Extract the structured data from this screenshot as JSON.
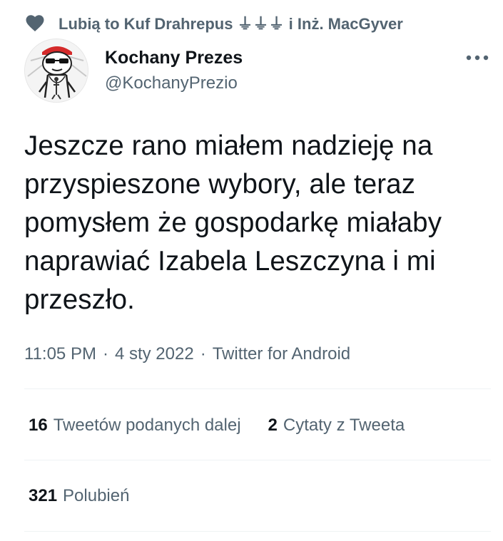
{
  "social_context": {
    "text": "Lubią to Kuf Drahrepus ⏚⏚⏚ i Inż. MacGyver",
    "icon": "heart-icon"
  },
  "author": {
    "display_name": "Kochany Prezes",
    "handle": "@KochanyPrezio",
    "avatar_icon": "avatar-cartoon"
  },
  "more_icon": "more-dots-icon",
  "tweet": {
    "text": "Jeszcze rano miałem nadzieję na\nprzyspieszone wybory, ale teraz\npomysłem że gospodarkę miałaby\nnaprawiać Izabela Leszczyna i mi\nprzeszło."
  },
  "meta": {
    "time": "11:05 PM",
    "sep1": "·",
    "date": "4 sty 2022",
    "sep2": "·",
    "source": "Twitter for Android"
  },
  "stats": {
    "retweets_count": "16",
    "retweets_label": "Tweetów podanych dalej",
    "quotes_count": "2",
    "quotes_label": "Cytaty z Tweeta",
    "likes_count": "321",
    "likes_label": "Polubień"
  },
  "colors": {
    "text_primary": "#0f1419",
    "text_secondary": "#536471",
    "divider": "#eff3f4"
  }
}
